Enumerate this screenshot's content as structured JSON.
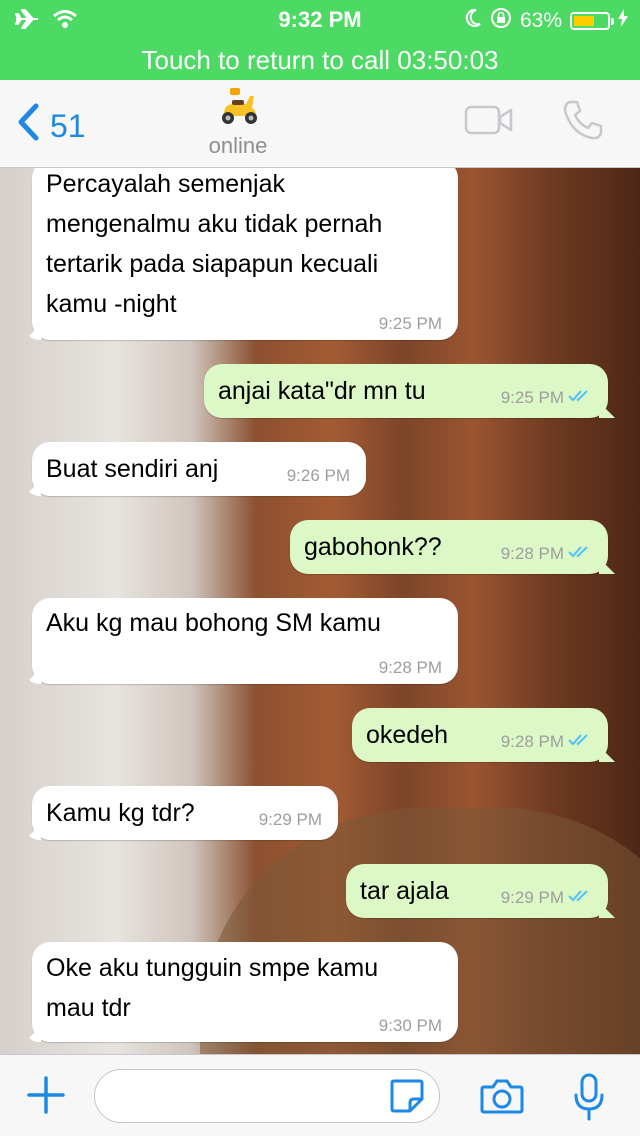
{
  "status_bar": {
    "time": "9:32 PM",
    "battery": "63%",
    "battery_level": 0.63,
    "icons": [
      "airplane-icon",
      "wifi-icon",
      "moon-icon",
      "rotation-lock-icon",
      "battery-icon",
      "charging-icon"
    ]
  },
  "call_banner": {
    "text": "Touch to return to call 03:50:03"
  },
  "nav": {
    "back_count": "51",
    "contact_status": "online",
    "icons": [
      "back-chevron-icon",
      "scooter-avatar",
      "video-call-icon",
      "phone-call-icon"
    ]
  },
  "colors": {
    "green": "#4cd964",
    "accent_blue": "#1e88e5",
    "outgoing_bubble": "#dcf8c6",
    "incoming_bubble": "#ffffff",
    "read_ticks": "#4fc3f7"
  },
  "messages": [
    {
      "dir": "in",
      "lines": [
        "Percayalah semenjak",
        "mengenalmu aku tidak pernah",
        "tertarik pada siapapun kecuali",
        "kamu -night"
      ],
      "time": "9:25 PM"
    },
    {
      "dir": "out",
      "lines": [
        "anjai kata\"dr mn tu"
      ],
      "time": "9:25 PM",
      "read": true
    },
    {
      "dir": "in",
      "lines": [
        "Buat sendiri anj"
      ],
      "time": "9:26 PM"
    },
    {
      "dir": "out",
      "lines": [
        "gabohonk??"
      ],
      "time": "9:28 PM",
      "read": true
    },
    {
      "dir": "in",
      "lines": [
        "Aku kg mau bohong SM kamu"
      ],
      "time": "9:28 PM"
    },
    {
      "dir": "out",
      "lines": [
        "okedeh"
      ],
      "time": "9:28 PM",
      "read": true
    },
    {
      "dir": "in",
      "lines": [
        "Kamu kg tdr?"
      ],
      "time": "9:29 PM"
    },
    {
      "dir": "out",
      "lines": [
        "tar ajala"
      ],
      "time": "9:29 PM",
      "read": true
    },
    {
      "dir": "in",
      "lines": [
        "Oke aku tungguin smpe kamu",
        "mau tdr"
      ],
      "time": "9:30 PM"
    }
  ],
  "input_bar": {
    "icons": [
      "plus-icon",
      "sticker-icon",
      "camera-icon",
      "microphone-icon"
    ]
  }
}
